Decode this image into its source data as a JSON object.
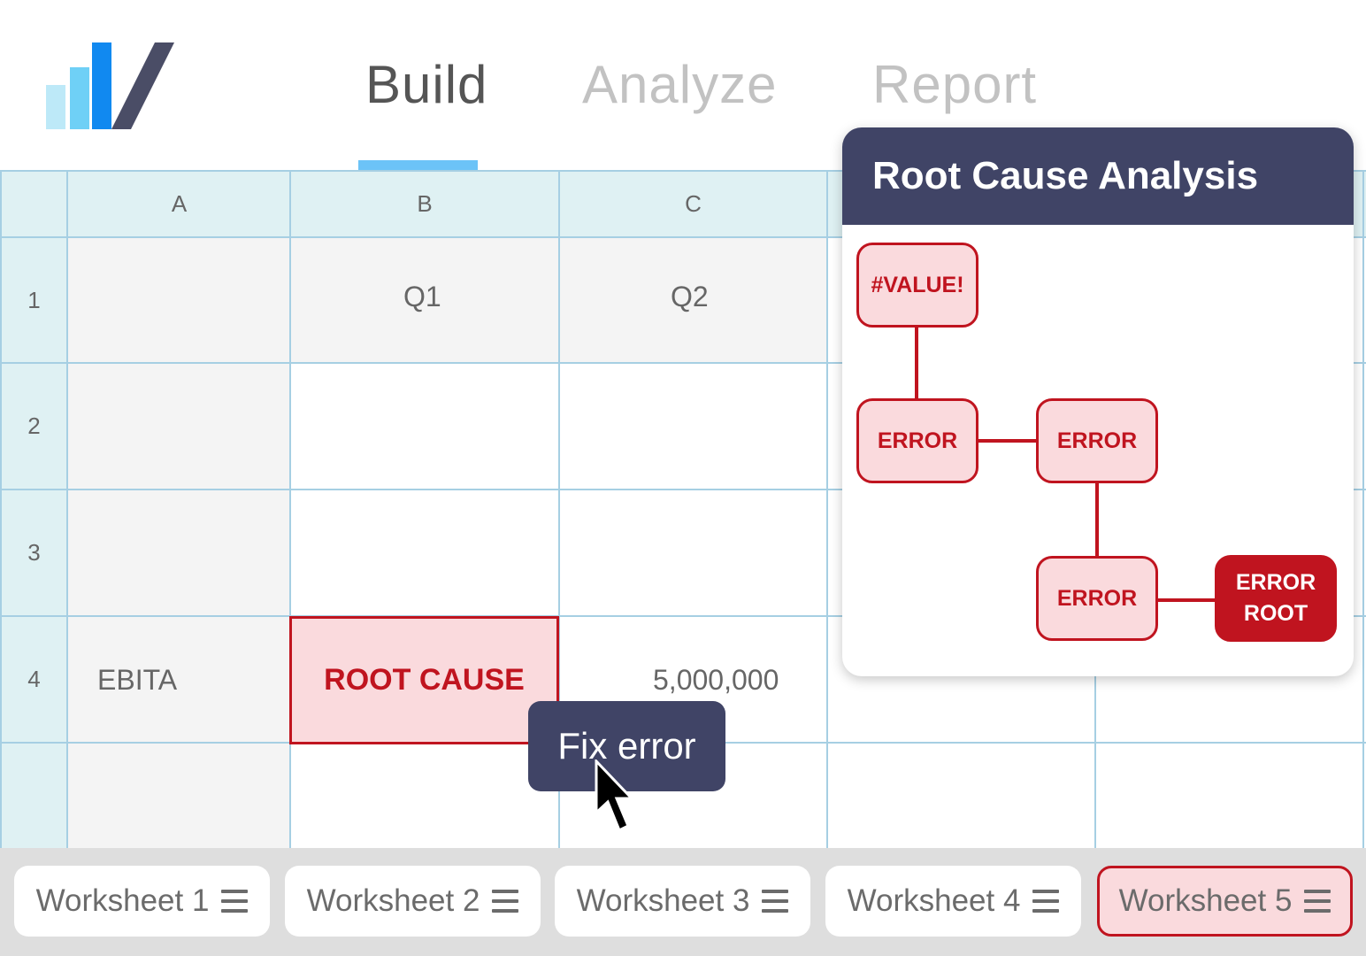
{
  "nav": {
    "tabs": [
      {
        "label": "Build",
        "active": true
      },
      {
        "label": "Analyze",
        "active": false
      },
      {
        "label": "Report",
        "active": false
      }
    ]
  },
  "grid": {
    "columns": [
      "A",
      "B",
      "C"
    ],
    "rows": [
      "1",
      "2",
      "3",
      "4"
    ],
    "cells": {
      "B1": "Q1",
      "C1": "Q2",
      "A4": "EBITA",
      "B4": "ROOT CAUSE",
      "C4": "5,000,000"
    }
  },
  "tooltip": {
    "label": "Fix error"
  },
  "panel": {
    "title": "Root Cause Analysis",
    "nodes": {
      "value": "#VALUE!",
      "error1": "ERROR",
      "error2": "ERROR",
      "error3": "ERROR",
      "root_line1": "ERROR",
      "root_line2": "ROOT"
    }
  },
  "sheets": [
    {
      "label": "Worksheet 1",
      "active": false
    },
    {
      "label": "Worksheet 2",
      "active": false
    },
    {
      "label": "Worksheet 3",
      "active": false
    },
    {
      "label": "Worksheet 4",
      "active": false
    },
    {
      "label": "Worksheet 5",
      "active": true
    }
  ],
  "colors": {
    "accent_navy": "#404466",
    "error_red": "#c0141f",
    "error_fill": "#fadadd",
    "tab_underline": "#6cc3f7",
    "header_fill": "#dff1f3",
    "grid_line": "#a6cfe3"
  }
}
